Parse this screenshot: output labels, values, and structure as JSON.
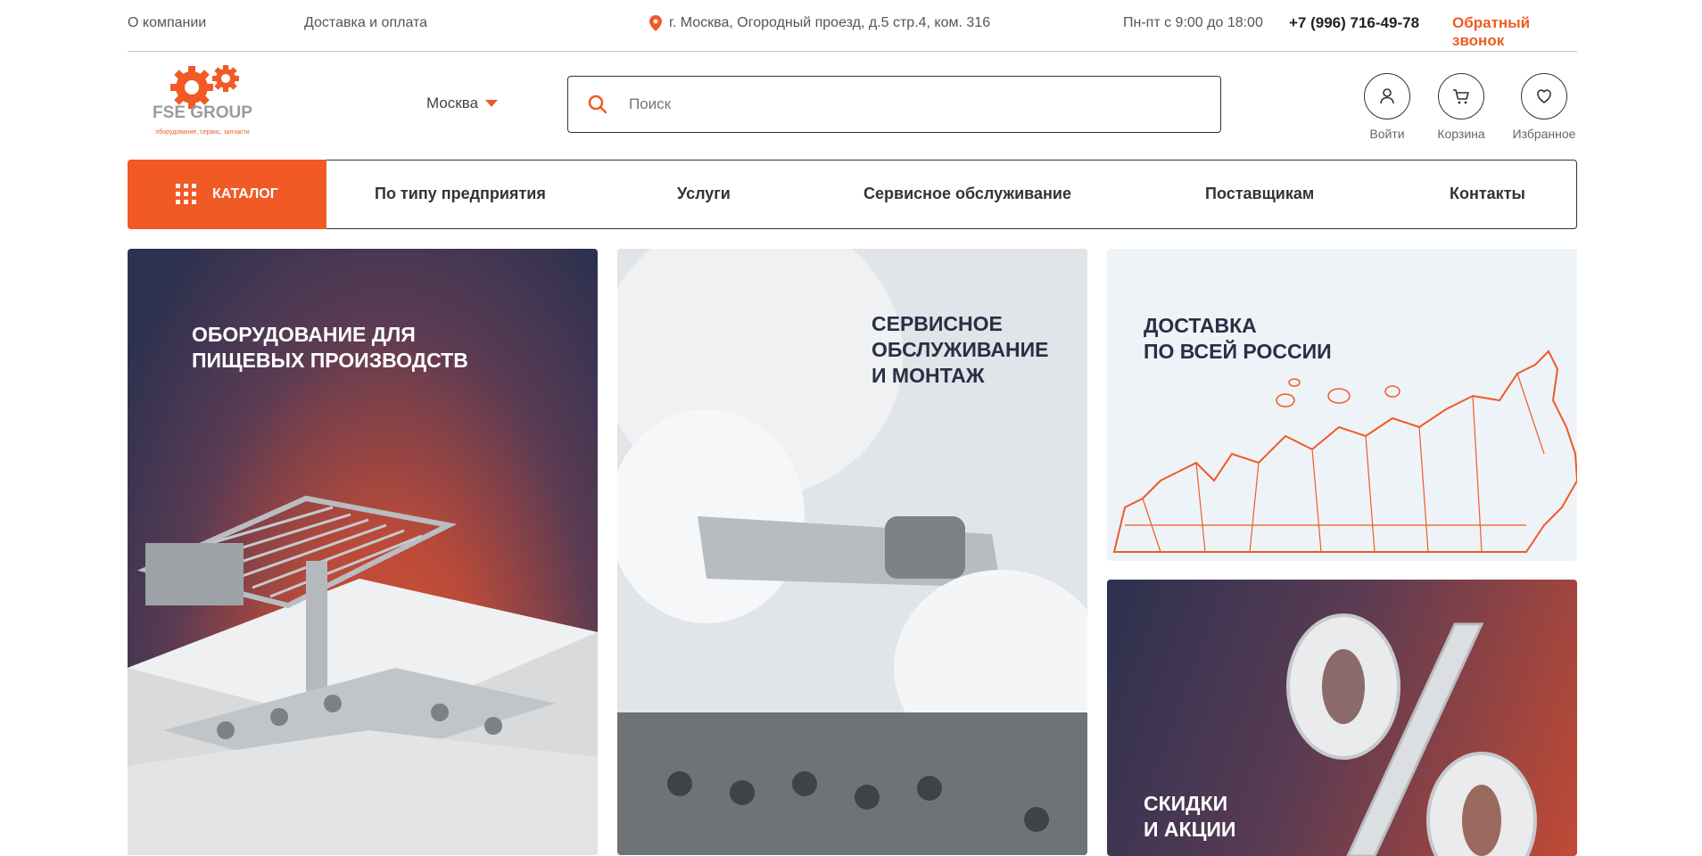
{
  "topbar": {
    "about": "О компании",
    "delivery": "Доставка и оплата",
    "address": "г. Москва, Огородный проезд, д.5 стр.4, ком. 316",
    "hours": "Пн-пт с 9:00 до 18:00",
    "phone": "+7 (996) 716-49-78",
    "callback": "Обратный звонок"
  },
  "logo": {
    "name": "FSE GROUP",
    "tagline": "оборудование, сервис, запчасти"
  },
  "header": {
    "city": "Москва",
    "search_placeholder": "Поиск",
    "login": "Войти",
    "cart": "Корзина",
    "favorites": "Избранное"
  },
  "nav": {
    "catalog": "КАТАЛОГ",
    "items": [
      "По типу предприятия",
      "Услуги",
      "Сервисное обслуживание",
      "Поставщикам",
      "Контакты"
    ]
  },
  "banners": {
    "food": [
      "ОБОРУДОВАНИЕ ДЛЯ",
      "ПИЩЕВЫХ ПРОИЗВОДСТВ"
    ],
    "service": [
      "СЕРВИСНОЕ",
      "ОБСЛУЖИВАНИЕ",
      "И МОНТАЖ"
    ],
    "delivery": [
      "ДОСТАВКА",
      "ПО ВСЕЙ РОССИИ"
    ],
    "sales": [
      "СКИДКИ",
      "И АКЦИИ"
    ]
  },
  "colors": {
    "accent": "#f15a24",
    "dark": "#2a2f45"
  }
}
